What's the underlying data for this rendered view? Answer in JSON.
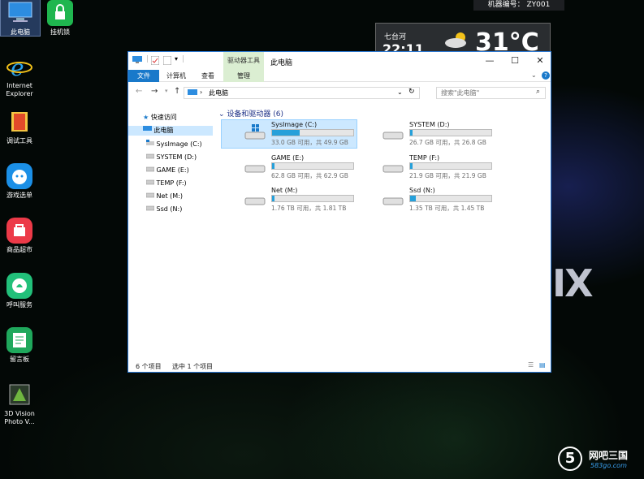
{
  "desktop_icons": [
    {
      "label": "此电脑",
      "icon": "computer-icon"
    },
    {
      "label": "挂机锁",
      "icon": "lock-icon"
    },
    {
      "label": "Internet Explorer",
      "icon": "ie-icon"
    },
    {
      "label": "调试工具",
      "icon": "folder-icon"
    },
    {
      "label": "游戏选单",
      "icon": "game-icon"
    },
    {
      "label": "商品超市",
      "icon": "shop-icon"
    },
    {
      "label": "呼叫服务",
      "icon": "bell-icon"
    },
    {
      "label": "留言板",
      "icon": "note-icon"
    },
    {
      "label": "3D Vision Photo V...",
      "icon": "3d-vision-icon"
    }
  ],
  "machine_id": "机器编号： ZY001",
  "weather": {
    "location": "七台河",
    "time": "22:11",
    "temperature": "31°C"
  },
  "background_text": "IX",
  "window": {
    "title": "此电脑",
    "context_tab": "驱动器工具",
    "ribbon_tabs": [
      "文件",
      "计算机",
      "查看",
      "管理"
    ],
    "address": "此电脑",
    "search_placeholder": "搜索\"此电脑\"",
    "nav": {
      "quick_access": "快速访问",
      "this_pc": "此电脑",
      "drives": [
        "SysImage (C:)",
        "SYSTEM (D:)",
        "GAME (E:)",
        "TEMP (F:)",
        "Net (M:)",
        "Ssd (N:)"
      ]
    },
    "group_header": "设备和驱动器 (6)",
    "drives": [
      {
        "name": "SysImage (C:)",
        "info": "33.0 GB 可用，共 49.9 GB",
        "used_fraction": 0.34,
        "icon": "windows-drive-icon"
      },
      {
        "name": "SYSTEM (D:)",
        "info": "26.7 GB 可用，共 26.8 GB",
        "used_fraction": 0.004,
        "icon": "drive-icon"
      },
      {
        "name": "GAME (E:)",
        "info": "62.8 GB 可用，共 62.9 GB",
        "used_fraction": 0.002,
        "icon": "drive-icon"
      },
      {
        "name": "TEMP (F:)",
        "info": "21.9 GB 可用，共 21.9 GB",
        "used_fraction": 0.0,
        "icon": "drive-icon"
      },
      {
        "name": "Net (M:)",
        "info": "1.76 TB 可用，共 1.81 TB",
        "used_fraction": 0.03,
        "icon": "drive-icon"
      },
      {
        "name": "Ssd (N:)",
        "info": "1.35 TB 可用，共 1.45 TB",
        "used_fraction": 0.07,
        "icon": "drive-icon"
      }
    ],
    "status": {
      "count": "6 个项目",
      "selected": "选中 1 个项目"
    }
  },
  "logo": {
    "text": "网吧三国",
    "url_text": "583go.com"
  }
}
